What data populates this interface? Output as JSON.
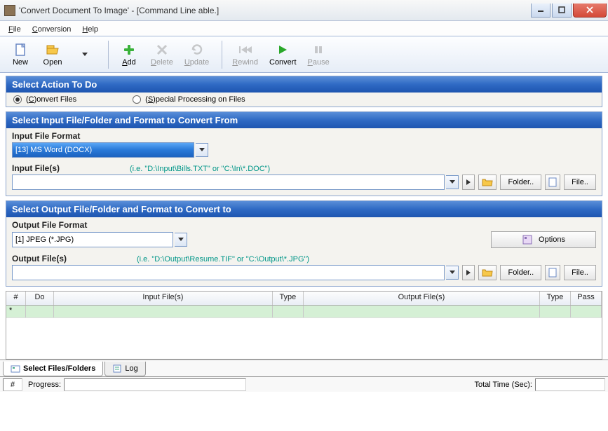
{
  "title": "'Convert Document To Image' - [Command Line able.]",
  "menu": {
    "file": "File",
    "conversion": "Conversion",
    "help": "Help"
  },
  "toolbar": {
    "new": "New",
    "open": "Open",
    "add": "Add",
    "delete": "Delete",
    "update": "Update",
    "rewind": "Rewind",
    "convert": "Convert",
    "pause": "Pause"
  },
  "panels": {
    "action": {
      "title": "Select Action To Do",
      "convert": "onvert Files",
      "special": "pecial Processing on Files"
    },
    "input": {
      "title": "Select Input File/Folder and Format to Convert From",
      "format_label": "Input File Format",
      "format_value": "[13] MS Word (DOCX)",
      "files_label": "Input File(s)",
      "hint": "(i.e. \"D:\\Input\\Bills.TXT\"  or \"C:\\In\\*.DOC\")",
      "folder_btn": "Folder..",
      "file_btn": "File.."
    },
    "output": {
      "title": "Select Output File/Folder and Format to Convert to",
      "format_label": "Output File Format",
      "format_value": "[1] JPEG (*.JPG)",
      "options_btn": "Options",
      "files_label": "Output File(s)",
      "hint": "(i.e. \"D:\\Output\\Resume.TIF\" or \"C:\\Output\\*.JPG\")",
      "folder_btn": "Folder..",
      "file_btn": "File.."
    }
  },
  "table": {
    "cols": {
      "num": "#",
      "do": "Do",
      "input": "Input File(s)",
      "type": "Type",
      "output": "Output File(s)",
      "type2": "Type",
      "pass": "Pass"
    },
    "star": "*"
  },
  "tabs": {
    "select": "Select Files/Folders",
    "log": "Log"
  },
  "status": {
    "hash": "#",
    "progress_label": "Progress:",
    "total_label": "Total Time (Sec):"
  }
}
